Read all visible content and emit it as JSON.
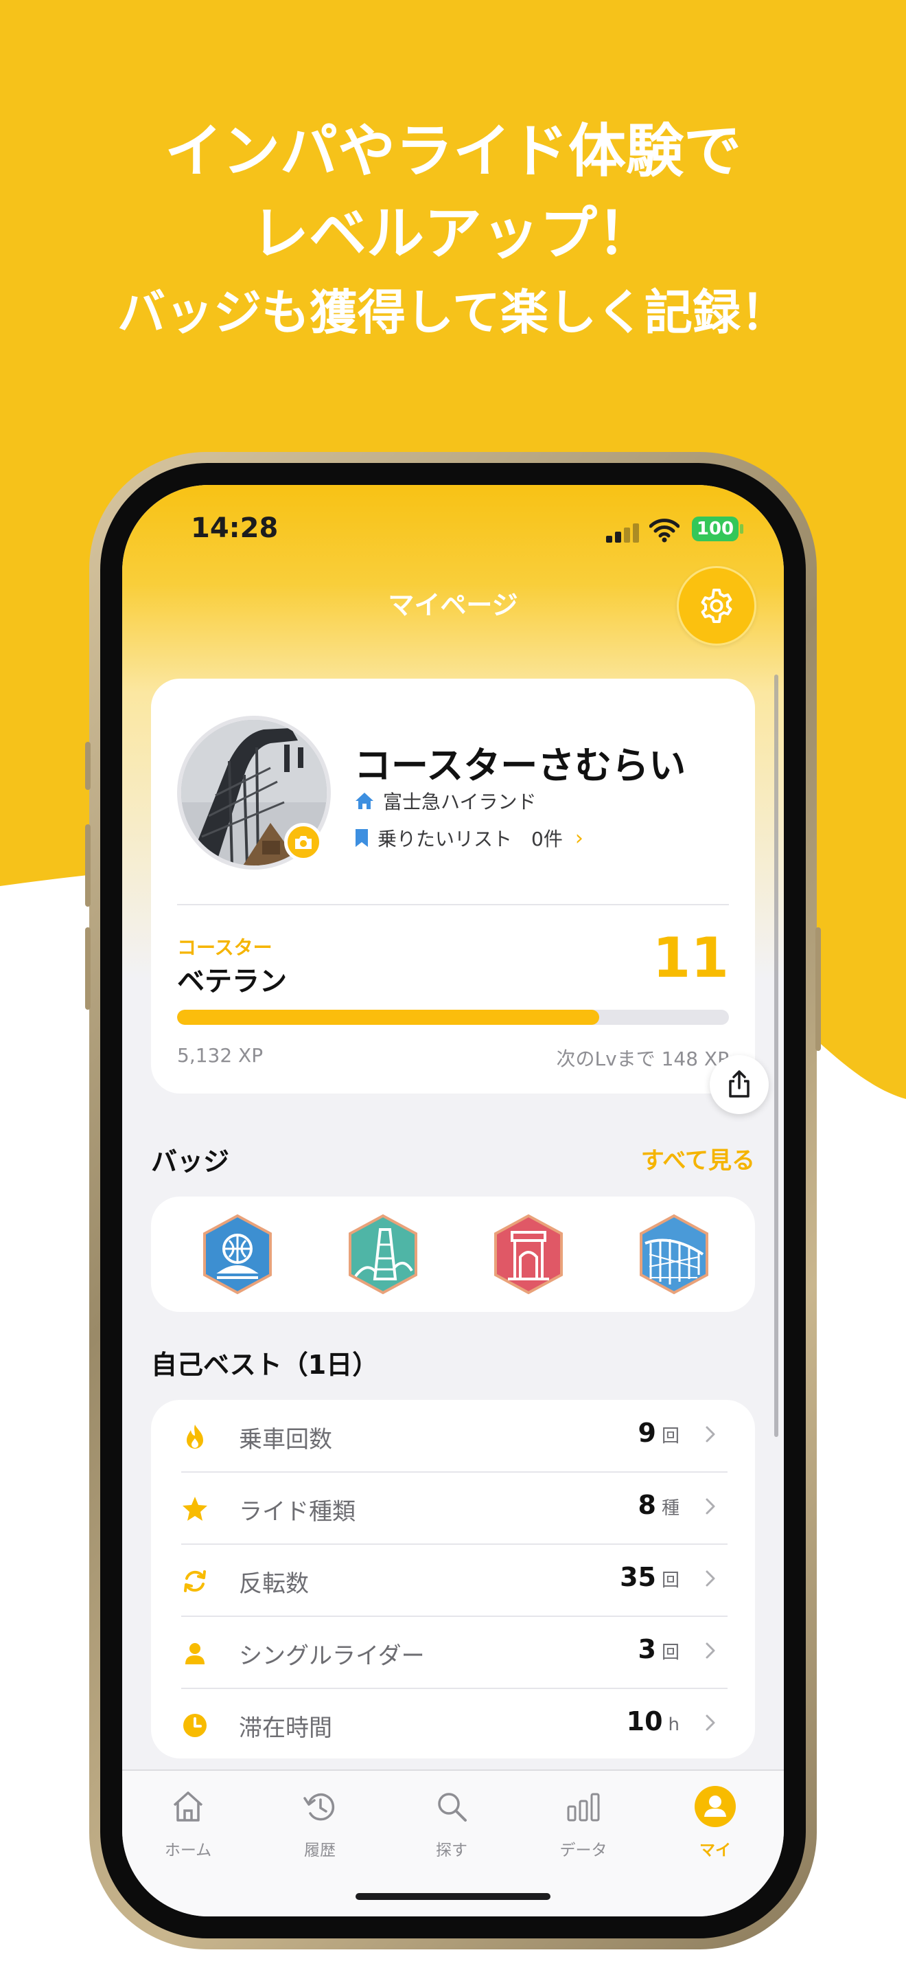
{
  "colors": {
    "brand_yellow": "#f6c21a",
    "accent": "#f5b400",
    "progress": "#fbbd0c",
    "battery": "#34c759"
  },
  "promo": {
    "line1": "インパやライド体験で",
    "line2": "レベルアップ！",
    "line3": "バッジも獲得して楽しく記録！"
  },
  "status_bar": {
    "time": "14:28",
    "battery": "100"
  },
  "header": {
    "title": "マイページ",
    "settings_icon": "gear-icon"
  },
  "profile": {
    "username": "コースターさむらい",
    "home_park": "富士急ハイランド",
    "wishlist_label": "乗りたいリスト",
    "wishlist_count": "0件",
    "level_category": "コースター",
    "level_name": "ベテラン",
    "level": "11",
    "xp_current": "5,132 XP",
    "xp_next": "次のLvまで 148 XP",
    "xp_progress": 0.765
  },
  "badges": {
    "title": "バッジ",
    "see_all": "すべて見る",
    "items": [
      {
        "icon": "globe-fountain-badge-icon",
        "color": "#3d8fd1"
      },
      {
        "icon": "coaster-tower-badge-icon",
        "color": "#4fb5a6"
      },
      {
        "icon": "gate-badge-icon",
        "color": "#e05866"
      },
      {
        "icon": "coaster-track-badge-icon",
        "color": "#4a9ad8"
      }
    ]
  },
  "personal_best": {
    "title": "自己ベスト（1日）",
    "rows": [
      {
        "icon": "flame-icon",
        "label": "乗車回数",
        "value": "9",
        "unit": "回"
      },
      {
        "icon": "star-icon",
        "label": "ライド種類",
        "value": "8",
        "unit": "種"
      },
      {
        "icon": "loop-icon",
        "label": "反転数",
        "value": "35",
        "unit": "回"
      },
      {
        "icon": "person-icon",
        "label": "シングルライダー",
        "value": "3",
        "unit": "回"
      },
      {
        "icon": "clock-icon",
        "label": "滞在時間",
        "value": "10",
        "unit": "h"
      }
    ]
  },
  "tabs": [
    {
      "icon": "home-icon",
      "label": "ホーム"
    },
    {
      "icon": "history-icon",
      "label": "履歴"
    },
    {
      "icon": "search-icon",
      "label": "探す"
    },
    {
      "icon": "bar-chart-icon",
      "label": "データ"
    },
    {
      "icon": "profile-icon",
      "label": "マイ",
      "active": true
    }
  ]
}
